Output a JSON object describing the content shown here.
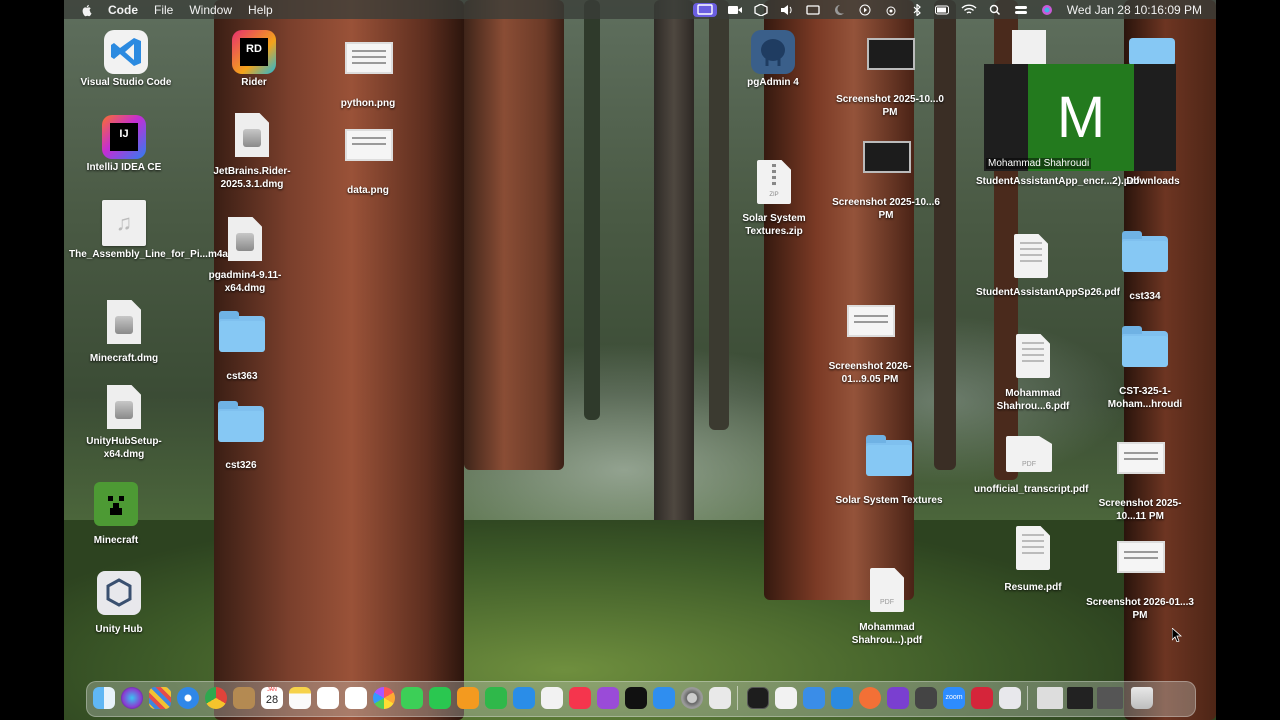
{
  "menubar": {
    "app_name": "Code",
    "menus": [
      "File",
      "Window",
      "Help"
    ],
    "clock": "Wed Jan 28  10:16:09 PM"
  },
  "desktop": {
    "items": [
      {
        "label": "Visual Studio Code",
        "kind": "app-vscode"
      },
      {
        "label": "IntelliJ IDEA CE",
        "kind": "app-intellij"
      },
      {
        "label": "The_Assembly_Line_for_Pi...m4a",
        "kind": "audio-file"
      },
      {
        "label": "Minecraft.dmg",
        "kind": "dmg"
      },
      {
        "label": "UnityHubSetup-x64.dmg",
        "kind": "dmg"
      },
      {
        "label": "Minecraft",
        "kind": "app-minecraft"
      },
      {
        "label": "Unity Hub",
        "kind": "app-unity"
      },
      {
        "label": "Rider",
        "kind": "app-rider"
      },
      {
        "label": "JetBrains.Rider-2025.3.1.dmg",
        "kind": "dmg"
      },
      {
        "label": "pgadmin4-9.11-x64.dmg",
        "kind": "dmg"
      },
      {
        "label": "cst363",
        "kind": "folder"
      },
      {
        "label": "cst326",
        "kind": "folder"
      },
      {
        "label": "python.png",
        "kind": "image"
      },
      {
        "label": "data.png",
        "kind": "image"
      },
      {
        "label": "pgAdmin 4",
        "kind": "app-pgadmin"
      },
      {
        "label": "Solar System Textures.zip",
        "kind": "zip"
      },
      {
        "label": "Screenshot 2025-10...0 PM",
        "kind": "screenshot-dark"
      },
      {
        "label": "Screenshot 2025-10...6 PM",
        "kind": "screenshot-dark"
      },
      {
        "label": "Screenshot 2026-01...9.05 PM",
        "kind": "screenshot"
      },
      {
        "label": "Solar System Textures",
        "kind": "folder"
      },
      {
        "label": "Mohammad Shahrou...).pdf",
        "kind": "pdf"
      },
      {
        "label": "StudentAssistantApp_encr...2).pdf",
        "kind": "doc"
      },
      {
        "label": "StudentAssistantAppSp26.pdf",
        "kind": "doc"
      },
      {
        "label": "Mohammad Shahrou...6.pdf",
        "kind": "doc"
      },
      {
        "label": "unofficial_transcript.pdf",
        "kind": "pdf"
      },
      {
        "label": "Resume.pdf",
        "kind": "doc"
      },
      {
        "label": "Downloads",
        "kind": "folder"
      },
      {
        "label": "cst334",
        "kind": "folder"
      },
      {
        "label": "CST-325-1-Moham...hroudi",
        "kind": "folder"
      },
      {
        "label": "Screenshot 2025-10...11 PM",
        "kind": "screenshot"
      },
      {
        "label": "Screenshot 2026-01...3 PM",
        "kind": "screenshot"
      }
    ]
  },
  "zoom_overlay": {
    "initial": "M",
    "participant_name": "Mohammad Shahroudi",
    "tile_color": "#237a1e"
  },
  "dock": {
    "apps": [
      "finder-icon",
      "siri-icon",
      "launchpad-icon",
      "safari-icon",
      "chrome-icon",
      "notes-folder-icon",
      "calendar-icon",
      "notes-icon",
      "freeform-icon",
      "reminders-icon",
      "photos-icon",
      "messages-icon",
      "facetime-icon",
      "pages-icon",
      "numbers-icon",
      "keynote-icon",
      "news-icon",
      "music-icon",
      "podcasts-icon",
      "tv-icon",
      "app-store-icon",
      "system-settings-icon",
      "preview-icon",
      "terminal-icon",
      "slack-icon",
      "mail-icon",
      "vscode-icon",
      "postman-icon",
      "github-desktop-icon",
      "unity-icon",
      "zoom-icon",
      "zoom-record-icon",
      "unity-hub-icon",
      "recent-window-1",
      "recent-window-2",
      "recent-window-3",
      "trash-icon"
    ],
    "calendar_day": "28",
    "calendar_month": "JAN",
    "zoom_label": "zoom"
  }
}
